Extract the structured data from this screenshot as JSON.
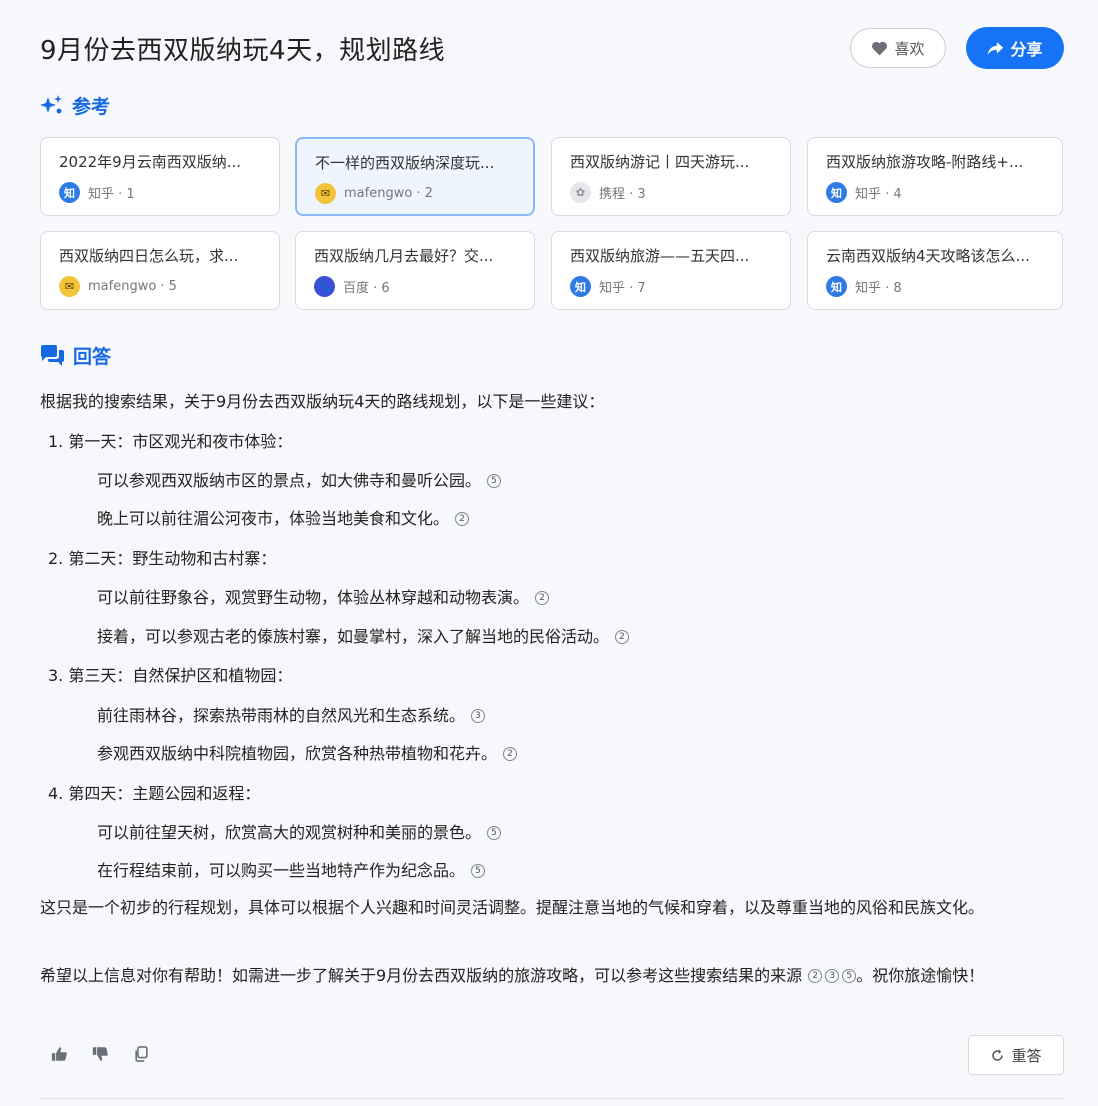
{
  "header": {
    "title": "9月份去西双版纳玩4天，规划路线",
    "like_label": "喜欢",
    "share_label": "分享"
  },
  "references": {
    "heading": "参考",
    "items": [
      {
        "title": "2022年9月云南西双版纳...",
        "source": "知乎 · 1",
        "icon": "zhihu-icon"
      },
      {
        "title": "不一样的西双版纳深度玩...",
        "source": "mafengwo · 2",
        "icon": "mafengwo-icon"
      },
      {
        "title": "西双版纳游记丨四天游玩...",
        "source": "携程 · 3",
        "icon": "ctrip-icon"
      },
      {
        "title": "西双版纳旅游攻略-附路线+...",
        "source": "知乎 · 4",
        "icon": "zhihu-icon"
      },
      {
        "title": "西双版纳四日怎么玩，求...",
        "source": "mafengwo · 5",
        "icon": "mafengwo-icon"
      },
      {
        "title": "西双版纳几月去最好？交...",
        "source": "百度 · 6",
        "icon": "baidu-icon"
      },
      {
        "title": "西双版纳旅游——五天四...",
        "source": "知乎 · 7",
        "icon": "zhihu-icon"
      },
      {
        "title": "云南西双版纳4天攻略该怎么...",
        "source": "知乎 · 8",
        "icon": "zhihu-icon"
      }
    ]
  },
  "answer": {
    "heading": "回答",
    "intro": "根据我的搜索结果，关于9月份去西双版纳玩4天的路线规划，以下是一些建议：",
    "days": [
      {
        "heading": "1. 第一天：市区观光和夜市体验：",
        "items": [
          {
            "text": "可以参观西双版纳市区的景点，如大佛寺和曼听公园。",
            "cite": "5"
          },
          {
            "text": "晚上可以前往湄公河夜市，体验当地美食和文化。",
            "cite": "2"
          }
        ]
      },
      {
        "heading": "2. 第二天：野生动物和古村寨：",
        "items": [
          {
            "text": "可以前往野象谷，观赏野生动物，体验丛林穿越和动物表演。",
            "cite": "2"
          },
          {
            "text": "接着，可以参观古老的傣族村寨，如曼掌村，深入了解当地的民俗活动。",
            "cite": "2"
          }
        ]
      },
      {
        "heading": "3. 第三天：自然保护区和植物园：",
        "items": [
          {
            "text": "前往雨林谷，探索热带雨林的自然风光和生态系统。",
            "cite": "3"
          },
          {
            "text": "参观西双版纳中科院植物园，欣赏各种热带植物和花卉。",
            "cite": "2"
          }
        ]
      },
      {
        "heading": "4. 第四天：主题公园和返程：",
        "items": [
          {
            "text": "可以前往望天树，欣赏高大的观赏树种和美丽的景色。",
            "cite": "5"
          },
          {
            "text": "在行程结束前，可以购买一些当地特产作为纪念品。",
            "cite": "5"
          }
        ]
      }
    ],
    "closing_1": "这只是一个初步的行程规划，具体可以根据个人兴趣和时间灵活调整。提醒注意当地的气候和穿着，以及尊重当地的风俗和民族文化。",
    "closing_2_before": "希望以上信息对你有帮助！如需进一步了解关于9月份去西双版纳的旅游攻略，可以参考这些搜索结果的来源",
    "closing_2_cites": [
      "2",
      "3",
      "5"
    ],
    "closing_2_after": "。祝你旅途愉快！"
  },
  "footer": {
    "regenerate_label": "重答"
  },
  "colors": {
    "accent": "#1673f5",
    "heading_blue": "#1668e3",
    "active_card_bg": "#eef5ff"
  }
}
